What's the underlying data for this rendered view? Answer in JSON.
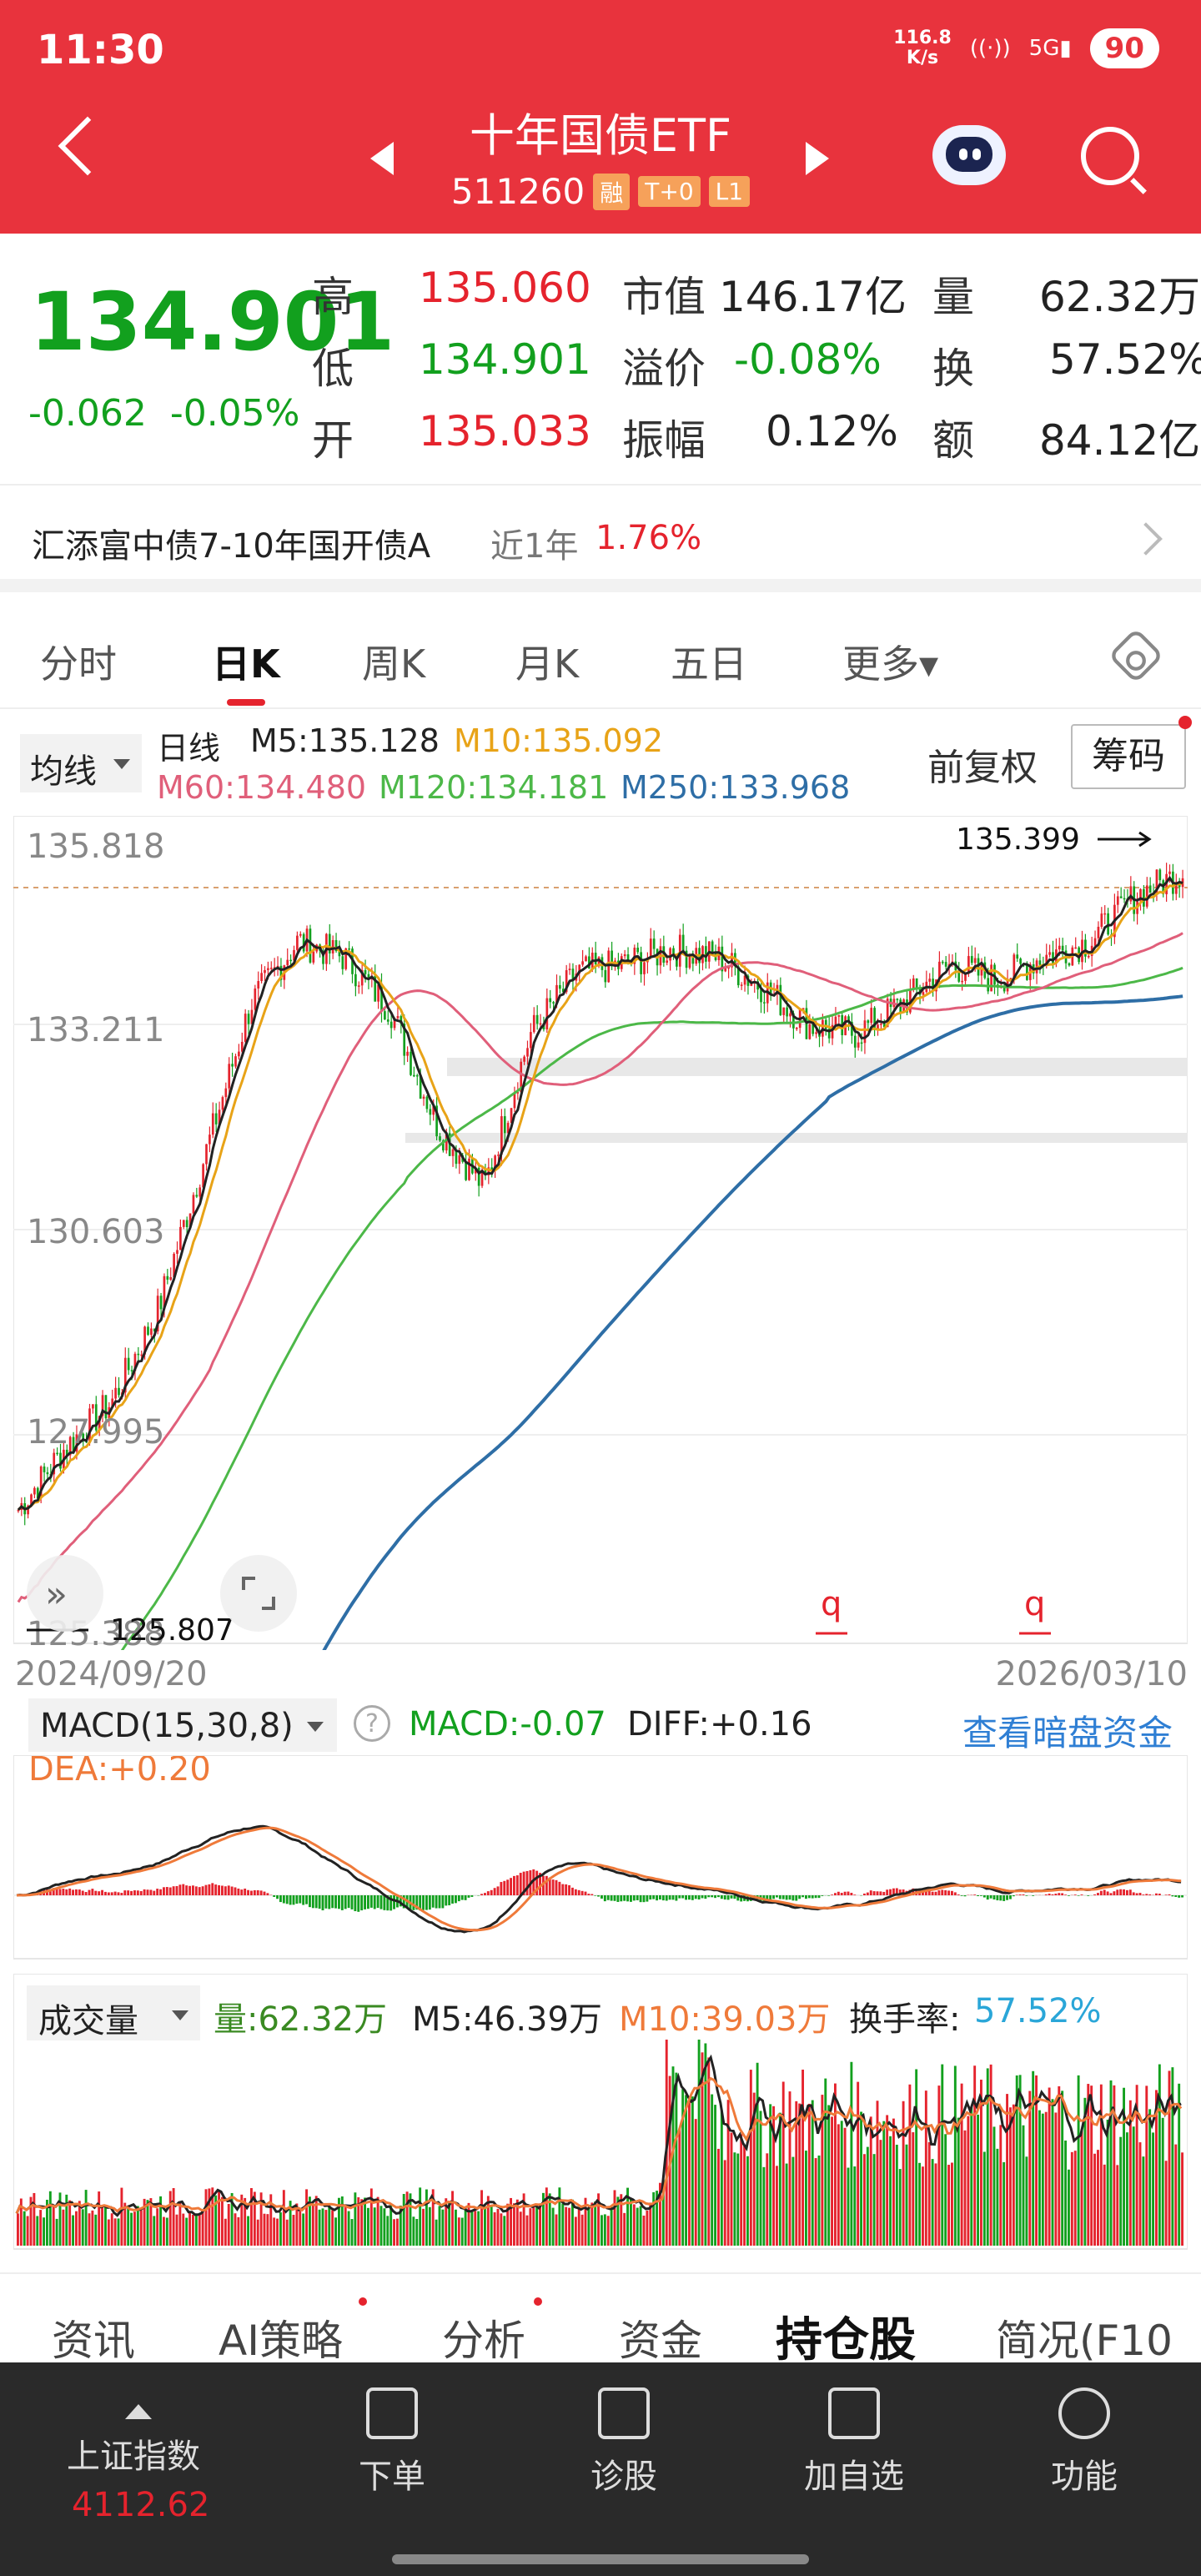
{
  "status": {
    "time": "11:30",
    "speed_value": "116.8",
    "speed_unit": "K/s",
    "battery": "90",
    "network": "5G"
  },
  "header": {
    "title": "十年国债ETF",
    "code": "511260",
    "tags": [
      "融",
      "T+0",
      "L1"
    ]
  },
  "quote": {
    "price": "134.901",
    "change": "-0.062",
    "change_pct": "-0.05%",
    "high_label": "高",
    "high": "135.060",
    "low_label": "低",
    "low": "134.901",
    "open_label": "开",
    "open": "135.033",
    "mcap_label": "市值",
    "mcap": "146.17亿",
    "premium_label": "溢价",
    "premium": "-0.08%",
    "amp_label": "振幅",
    "amp": "0.12%",
    "vol_label": "量",
    "vol": "62.32万",
    "turn_label": "换",
    "turn": "57.52%",
    "amt_label": "额",
    "amt": "84.12亿"
  },
  "fund": {
    "name": "汇添富中债7-10年国开债A",
    "period": "近1年",
    "return": "1.76%"
  },
  "tabs": [
    "分时",
    "日K",
    "周K",
    "月K",
    "五日",
    "更多▾"
  ],
  "ma": {
    "selector": "均线",
    "period": "日线",
    "m5": "M5:135.128",
    "m10": "M10:135.092",
    "m60": "M60:134.480",
    "m120": "M120:134.181",
    "m250": "M250:133.968",
    "fuquan": "前复权",
    "chouma": "筹码",
    "colors": {
      "m5": "#222222",
      "m10": "#e8a317",
      "m60": "#e05f7a",
      "m120": "#4cb848",
      "m250": "#2e6ea6"
    }
  },
  "chart_data": {
    "type": "candlestick",
    "y_ticks": [
      "135.818",
      "133.211",
      "130.603",
      "127.995",
      "125.388"
    ],
    "ylim": [
      125.388,
      135.818
    ],
    "high_marker": "135.399",
    "low_marker": "125.807",
    "x_start": "2024/09/20",
    "x_end": "2026/03/10",
    "markers": [
      "q",
      "q"
    ],
    "close_trend": [
      127.0,
      127.8,
      128.4,
      129.6,
      131.6,
      133.6,
      134.4,
      134.2,
      133.5,
      132.0,
      131.2,
      133.2,
      134.0,
      134.1,
      134.3,
      134.2,
      133.8,
      133.3,
      133.2,
      133.6,
      134.1,
      133.9,
      134.2,
      134.4,
      135.0,
      135.3
    ]
  },
  "macd": {
    "selector": "MACD(15,30,8)",
    "help": "?",
    "macd": "MACD:-0.07",
    "diff": "DIFF:+0.16",
    "dea": "DEA:+0.20",
    "link": "查看暗盘资金"
  },
  "volume": {
    "selector": "成交量",
    "vol": "量:62.32万",
    "m5": "M5:46.39万",
    "m10": "M10:39.03万",
    "turnover_label": "换手率:",
    "turnover": "57.52%"
  },
  "bottom_tabs": [
    "资讯",
    "AI策略",
    "分析",
    "资金",
    "持仓股",
    "简况(F10"
  ],
  "index": {
    "name": "上证指数",
    "value": "4112.62"
  },
  "nav": [
    "下单",
    "诊股",
    "加自选",
    "功能"
  ]
}
